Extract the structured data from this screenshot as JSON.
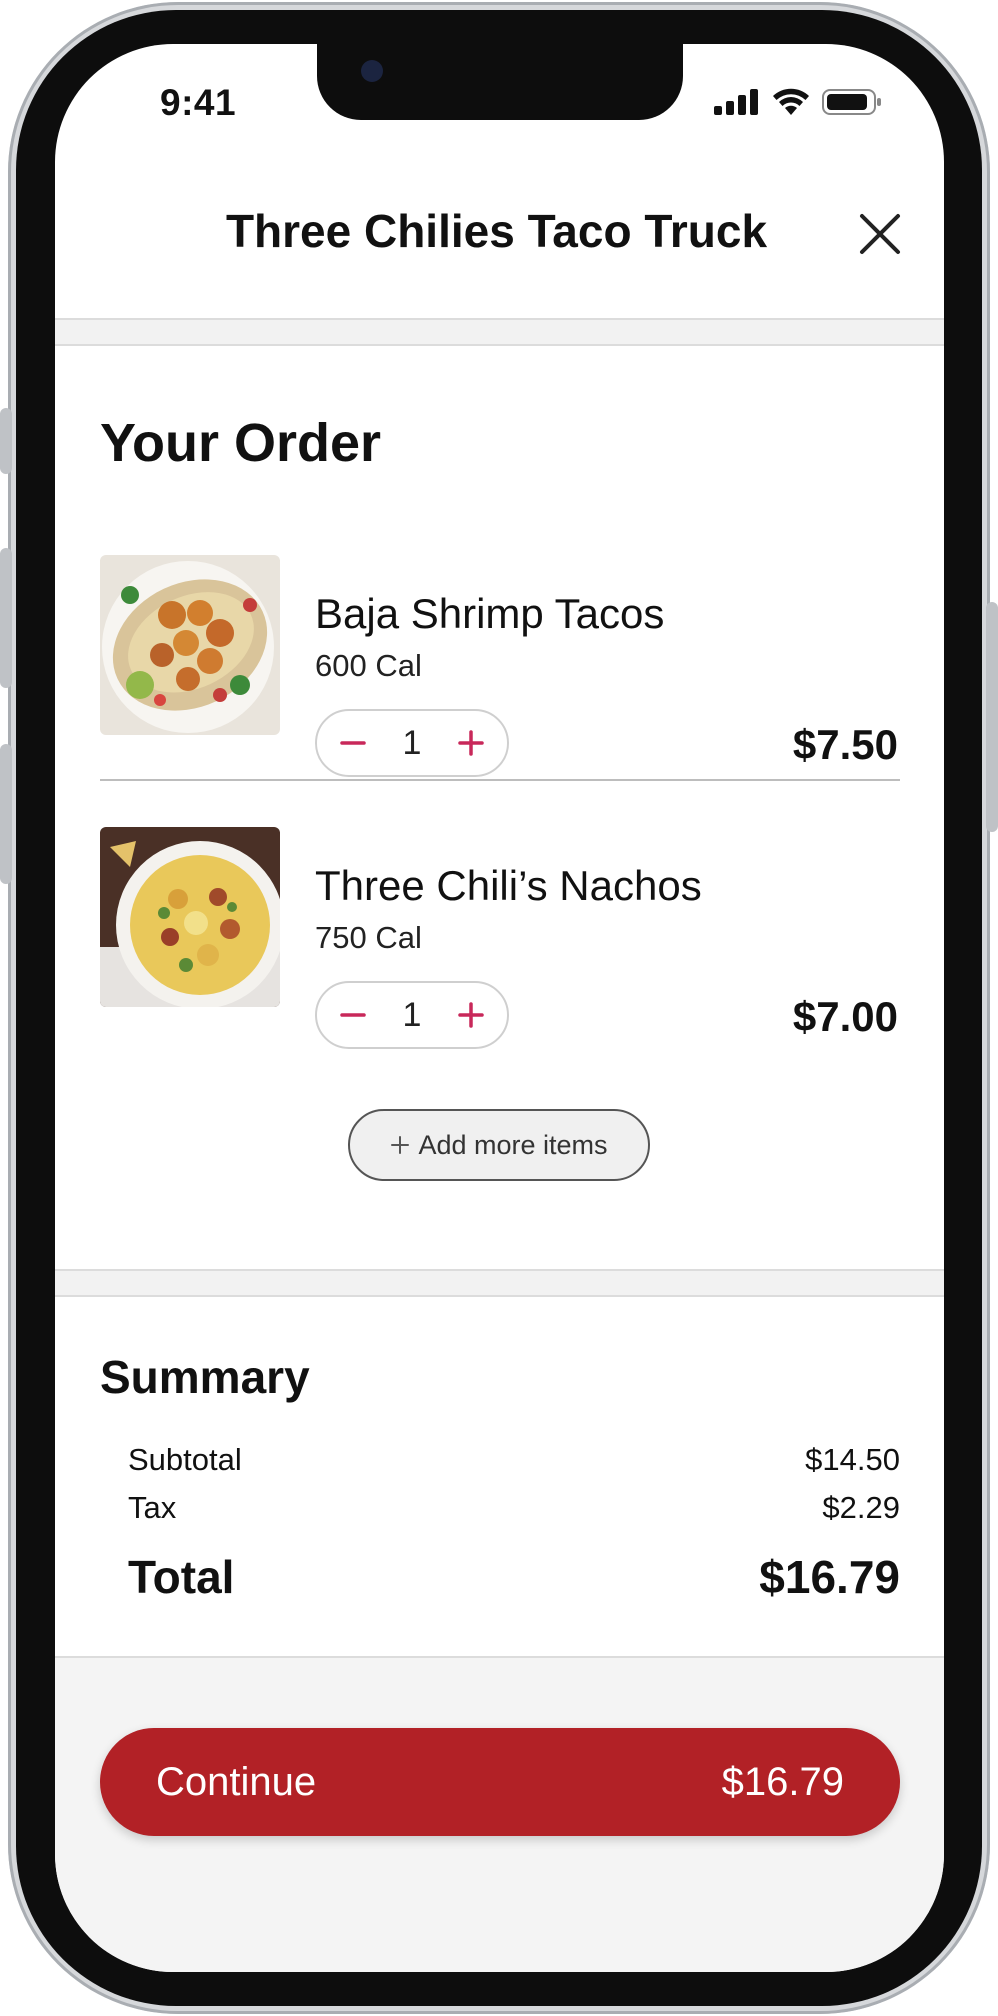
{
  "status_bar": {
    "time": "9:41"
  },
  "header": {
    "title": "Three Chilies Taco Truck"
  },
  "order": {
    "heading": "Your Order",
    "items": [
      {
        "name": "Baja Shrimp Tacos",
        "calories": "600 Cal",
        "quantity": "1",
        "price": "$7.50"
      },
      {
        "name": "Three Chili’s Nachos",
        "calories": "750 Cal",
        "quantity": "1",
        "price": "$7.00"
      }
    ],
    "add_more_label": "Add more items"
  },
  "summary": {
    "heading": "Summary",
    "subtotal_label": "Subtotal",
    "subtotal_value": "$14.50",
    "tax_label": "Tax",
    "tax_value": "$2.29",
    "total_label": "Total",
    "total_value": "$16.79"
  },
  "footer": {
    "continue_label": "Continue",
    "continue_amount": "$16.79"
  },
  "colors": {
    "accent": "#b22126",
    "stepper": "#c8285a",
    "band": "#f2f2f2"
  }
}
